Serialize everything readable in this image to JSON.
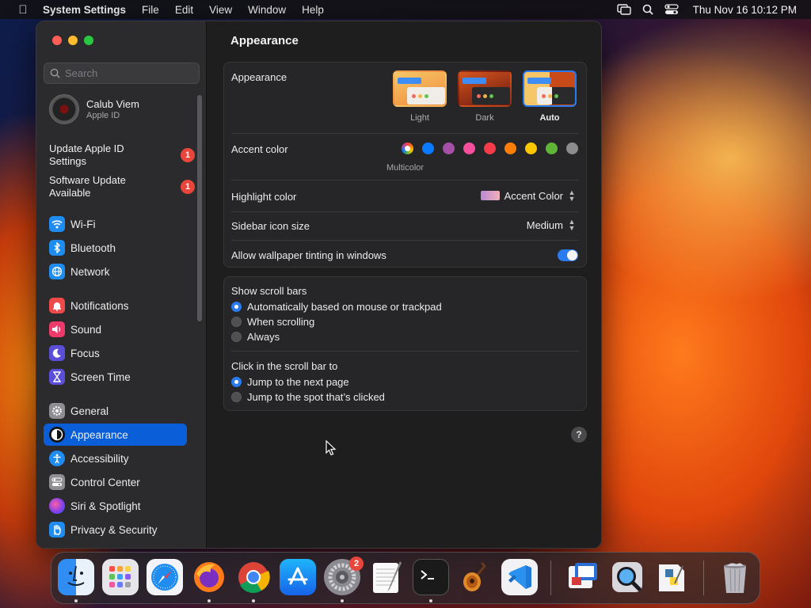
{
  "menubar": {
    "app_name": "System Settings",
    "items": [
      "File",
      "Edit",
      "View",
      "Window",
      "Help"
    ],
    "clock": "Thu Nov 16  10:12 PM"
  },
  "sidebar": {
    "search_placeholder": "Search",
    "account": {
      "name": "Calub Viem",
      "subtitle": "Apple ID"
    },
    "notices": [
      {
        "label": "Update Apple ID Settings",
        "badge": "1"
      },
      {
        "label": "Software Update Available",
        "badge": "1"
      }
    ],
    "items": [
      {
        "label": "Wi-Fi",
        "icon": "wifi-icon",
        "color": "#1f8cf0"
      },
      {
        "label": "Bluetooth",
        "icon": "bluetooth-icon",
        "color": "#1f8cf0"
      },
      {
        "label": "Network",
        "icon": "globe-icon",
        "color": "#1f8cf0"
      },
      {
        "label": "Notifications",
        "icon": "bell-icon",
        "color": "#ee4a4a"
      },
      {
        "label": "Sound",
        "icon": "speaker-icon",
        "color": "#ee3a6a"
      },
      {
        "label": "Focus",
        "icon": "moon-icon",
        "color": "#5b4ed8"
      },
      {
        "label": "Screen Time",
        "icon": "hourglass-icon",
        "color": "#5b4ed8"
      },
      {
        "label": "General",
        "icon": "gear-icon",
        "color": "#8e8e93"
      },
      {
        "label": "Appearance",
        "icon": "appearance-icon",
        "color": "#111111",
        "active": true
      },
      {
        "label": "Accessibility",
        "icon": "accessibility-icon",
        "color": "#1f8cf0"
      },
      {
        "label": "Control Center",
        "icon": "toggles-icon",
        "color": "#8e8e93"
      },
      {
        "label": "Siri & Spotlight",
        "icon": "siri-icon",
        "color": "#b04ad8"
      },
      {
        "label": "Privacy & Security",
        "icon": "hand-icon",
        "color": "#1f8cf0"
      }
    ]
  },
  "main": {
    "title": "Appearance",
    "appearance": {
      "label": "Appearance",
      "options": [
        {
          "label": "Light",
          "selected": false
        },
        {
          "label": "Dark",
          "selected": false
        },
        {
          "label": "Auto",
          "selected": true
        }
      ]
    },
    "accent": {
      "label": "Accent color",
      "caption": "Multicolor",
      "colors": [
        "multicolor",
        "#0a7aff",
        "#a550a7",
        "#f74f9e",
        "#f33b4a",
        "#fd7d09",
        "#fcc600",
        "#5fb636",
        "#8c8c8c"
      ]
    },
    "highlight": {
      "label": "Highlight color",
      "value": "Accent Color"
    },
    "icon_size": {
      "label": "Sidebar icon size",
      "value": "Medium"
    },
    "tinting": {
      "label": "Allow wallpaper tinting in windows",
      "on": true
    },
    "scroll_bars": {
      "label": "Show scroll bars",
      "options": [
        {
          "label": "Automatically based on mouse or trackpad",
          "selected": true
        },
        {
          "label": "When scrolling",
          "selected": false
        },
        {
          "label": "Always",
          "selected": false
        }
      ]
    },
    "click_scroll": {
      "label": "Click in the scroll bar to",
      "options": [
        {
          "label": "Jump to the next page",
          "selected": true
        },
        {
          "label": "Jump to the spot that’s clicked",
          "selected": false
        }
      ]
    },
    "help_label": "?"
  },
  "dock": {
    "apps": [
      "finder-icon",
      "launchpad-icon",
      "safari-icon",
      "firefox-icon",
      "chrome-icon",
      "app-store-icon",
      "system-settings-icon",
      "textedit-icon",
      "terminal-icon",
      "garageband-icon",
      "vscode-icon",
      "remote-desktop-icon",
      "quicktime-icon",
      "python-launcher-icon",
      "trash-icon"
    ],
    "settings_badge": "2"
  }
}
